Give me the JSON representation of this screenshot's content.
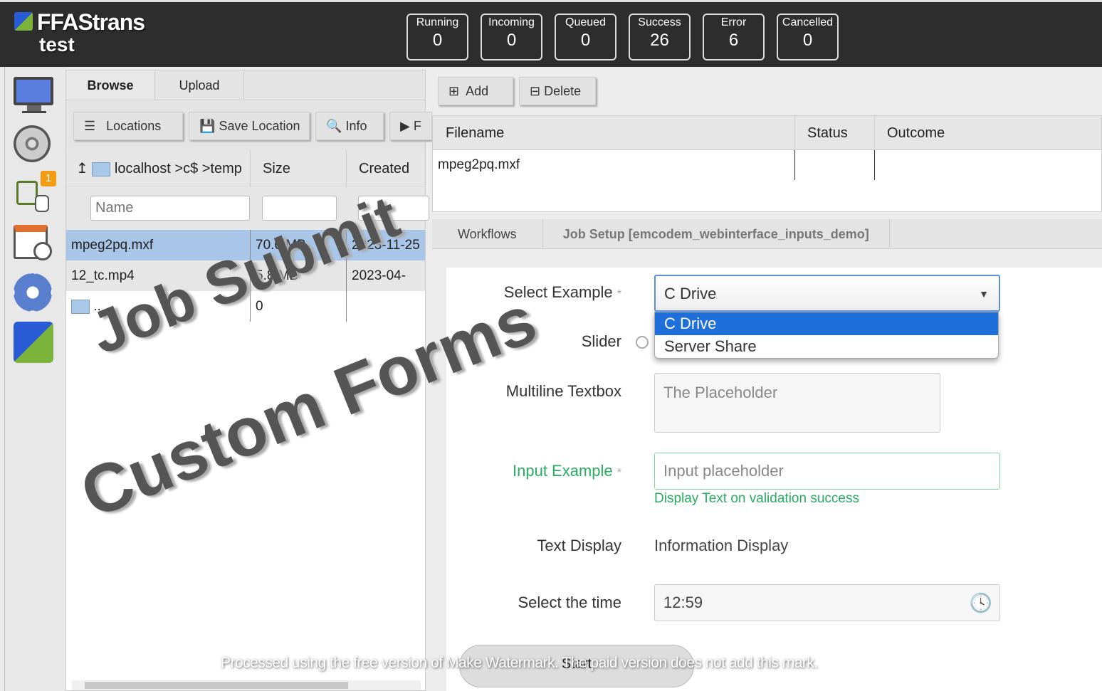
{
  "app": {
    "title": "FFAStrans",
    "subtitle": "test"
  },
  "stats": [
    {
      "label": "Running",
      "value": "0"
    },
    {
      "label": "Incoming",
      "value": "0"
    },
    {
      "label": "Queued",
      "value": "0"
    },
    {
      "label": "Success",
      "value": "26"
    },
    {
      "label": "Error",
      "value": "6"
    },
    {
      "label": "Cancelled",
      "value": "0"
    }
  ],
  "sidebar": {
    "badge": "1",
    "items": [
      "monitor-icon",
      "film-reel-icon",
      "workflow-icon",
      "calendar-clock-icon",
      "gear-icon",
      "ffastrans-logo-icon"
    ]
  },
  "browser": {
    "tabs": [
      "Browse",
      "Upload"
    ],
    "toolbar": {
      "locations": "Locations",
      "save_location": "Save Location",
      "info": "Info",
      "play": "F"
    },
    "path": "localhost >c$ >temp",
    "columns": {
      "size": "Size",
      "created": "Created"
    },
    "filters": {
      "name_placeholder": "Name"
    },
    "rows": [
      {
        "name": "mpeg2pq.mxf",
        "size": "70.6 MB",
        "created": "2023-11-25",
        "selected": true
      },
      {
        "name": "12_tc.mp4",
        "size": "5.8 MB",
        "created": "2023-04-"
      },
      {
        "name": "..",
        "size": "0",
        "created": ""
      }
    ]
  },
  "jobs": {
    "add": "Add",
    "delete": "Delete",
    "columns": [
      "Filename",
      "Status",
      "Outcome"
    ],
    "rows": [
      {
        "filename": "mpeg2pq.mxf",
        "status": "",
        "outcome": ""
      }
    ]
  },
  "right_tabs": [
    "Workflows",
    "Job Setup [emcodem_webinterface_inputs_demo]"
  ],
  "form": {
    "select_label": "Select Example",
    "select_value": "C Drive",
    "required_mark": "*",
    "options": [
      "C Drive",
      "Server Share"
    ],
    "slider_label": "Slider",
    "multiline_label": "Multiline Textbox",
    "multiline_placeholder": "The Placeholder",
    "input_label": "Input Example",
    "input_placeholder": "Input placeholder",
    "input_success": "Display Text on validation success",
    "text_display_label": "Text Display",
    "text_display_value": "Information Display",
    "time_label": "Select the time",
    "time_value": "12:59",
    "start": "Start"
  },
  "watermark": {
    "line1": "Job Submit",
    "line2": "Custom Forms",
    "footer": "Processed using the free version of Make Watermark. The paid version does not add this mark."
  },
  "colors": {
    "header": "#2d2d2d",
    "selected_row": "#a9c6e8",
    "option_highlight": "#1e6fd9",
    "success": "#27ae60",
    "badge": "#f39c12"
  }
}
